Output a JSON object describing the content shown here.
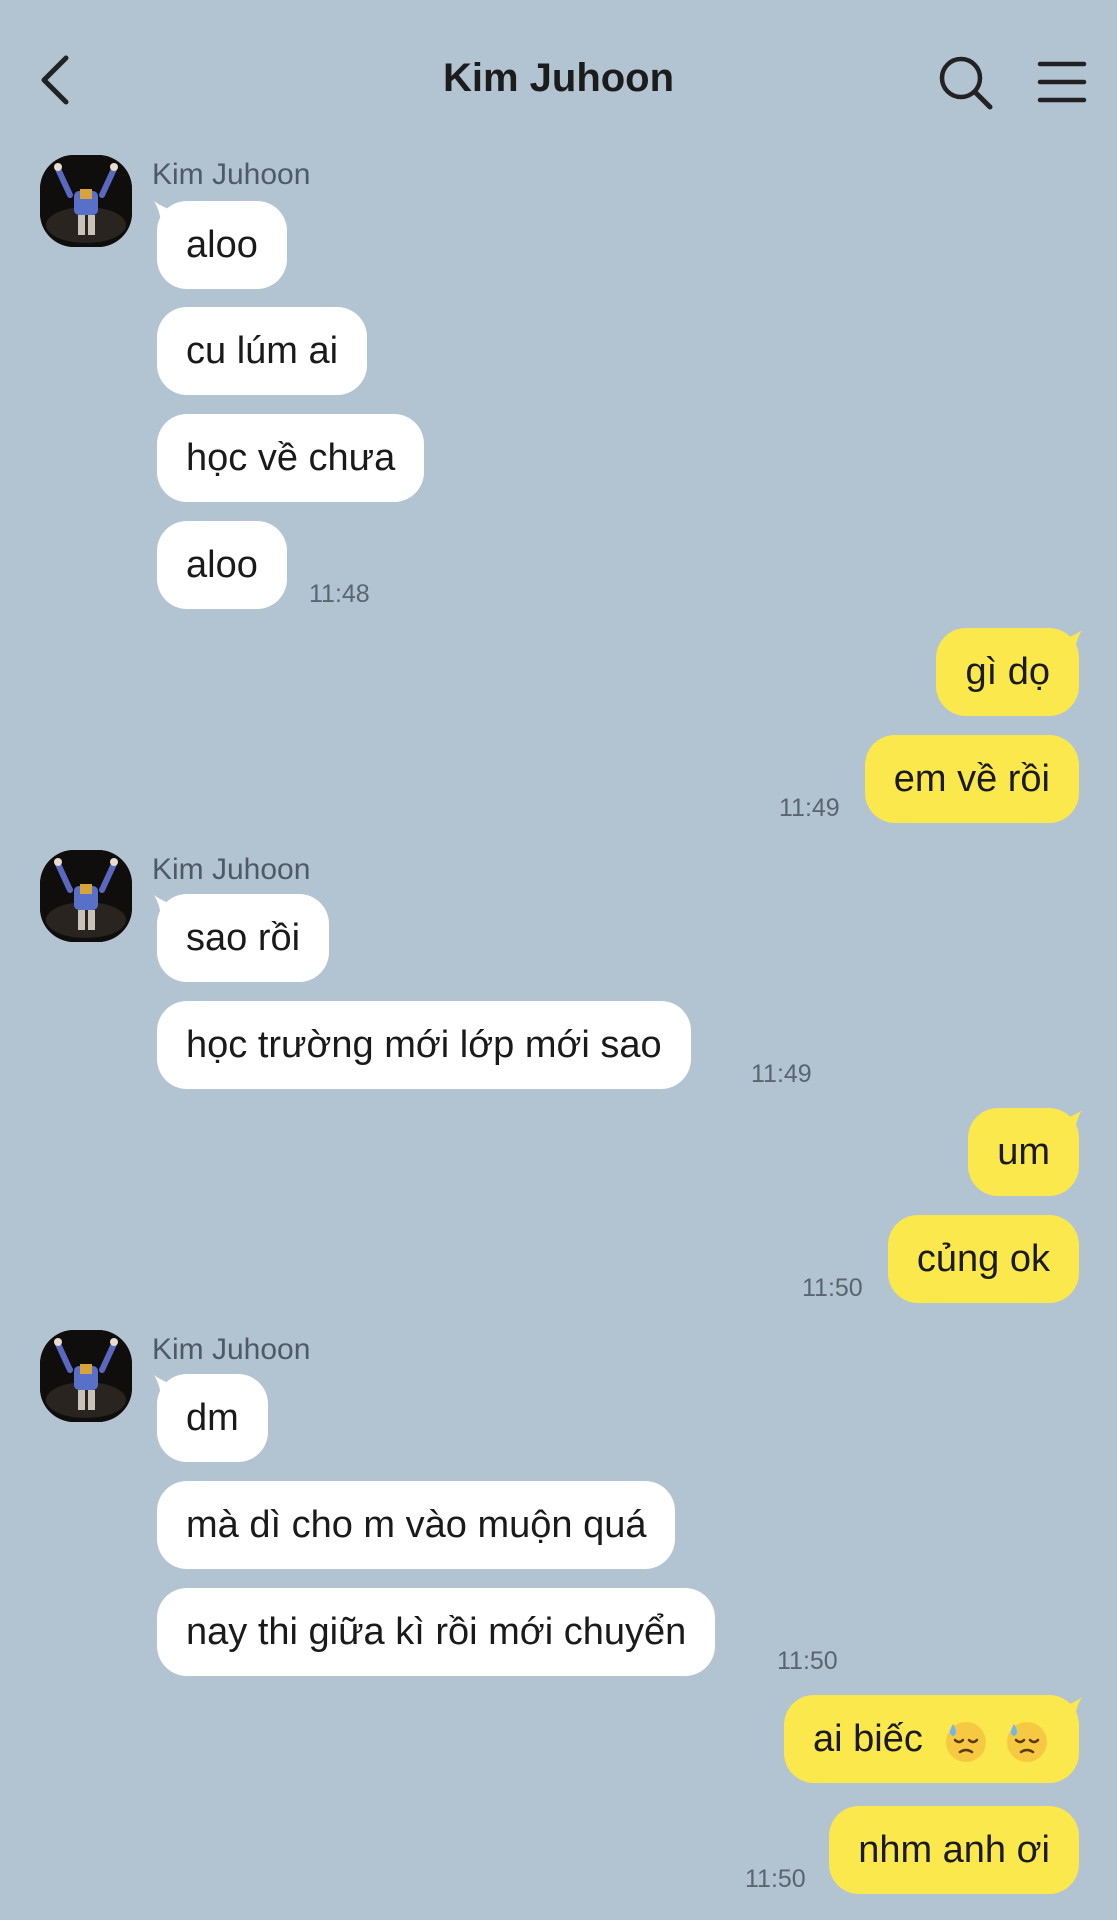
{
  "header": {
    "title": "Kim Juhoon",
    "back_icon": "chevron-left-icon",
    "search_icon": "search-icon",
    "menu_icon": "hamburger-menu-icon"
  },
  "colors": {
    "background": "#b2c3d2",
    "incoming_bubble": "#ffffff",
    "outgoing_bubble": "#fbe84c"
  },
  "messages": {
    "g1": {
      "sender": "Kim Juhoon",
      "m1": "aloo",
      "m2": "cu lúm ai",
      "m3": "học về chưa",
      "m4": "aloo",
      "time": "11:48"
    },
    "o1": {
      "m1": "gì dọ",
      "m2": "em về rồi",
      "time": "11:49"
    },
    "g2": {
      "sender": "Kim Juhoon",
      "m1": "sao rồi",
      "m2": "học trường mới lớp mới sao",
      "time": "11:49"
    },
    "o2": {
      "m1": "um",
      "m2": "củng ok",
      "time": "11:50"
    },
    "g3": {
      "sender": "Kim Juhoon",
      "m1": "dm",
      "m2": "mà dì cho m vào muộn quá",
      "m3": "nay thi giữa kì rồi mới chuyển",
      "time": "11:50"
    },
    "o3": {
      "m1_text": "ai biếc",
      "m1_emoji": "downcast-face-with-sweat-emoji",
      "m2": "nhm anh ơi",
      "time": "11:50"
    }
  }
}
